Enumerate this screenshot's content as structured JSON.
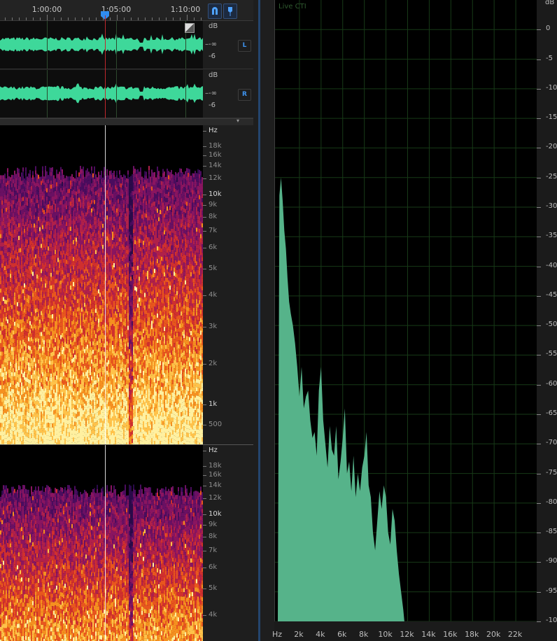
{
  "timeline": {
    "labels": [
      "1:00:00",
      "1:05:00",
      "1:10:00"
    ],
    "playhead": "1:04:25"
  },
  "waveform": {
    "unit": "dB",
    "channels": [
      {
        "badge": "L",
        "scale": [
          "-∞",
          "-6"
        ]
      },
      {
        "badge": "R",
        "scale": [
          "-∞",
          "-6"
        ]
      }
    ],
    "color": "#3ed89a"
  },
  "spectral": {
    "unit": "Hz",
    "top_labels": [
      "18k",
      "16k",
      "14k",
      "12k",
      "10k",
      "9k",
      "8k",
      "7k",
      "6k",
      "5k",
      "4k",
      "3k",
      "2k",
      "1k",
      "500"
    ],
    "bottom_labels": [
      "18k",
      "16k",
      "14k",
      "12k",
      "10k",
      "9k",
      "8k",
      "7k",
      "6k",
      "5k",
      "4k"
    ]
  },
  "frequency_analysis": {
    "live_label": "Live CTI",
    "y_unit": "dB",
    "y_labels": [
      "0",
      "-5",
      "-10",
      "-15",
      "-20",
      "-25",
      "-30",
      "-35",
      "-40",
      "-45",
      "-50",
      "-55",
      "-60",
      "-65",
      "-70",
      "-75",
      "-80",
      "-85",
      "-90",
      "-95",
      "-100"
    ],
    "x_unit": "Hz",
    "x_labels": [
      "2k",
      "4k",
      "6k",
      "8k",
      "10k",
      "12k",
      "14k",
      "16k",
      "18k",
      "20k",
      "22k"
    ],
    "bar_color": "#56b38a"
  },
  "chart_data": {
    "type": "area",
    "title": "",
    "xlabel": "Hz",
    "ylabel": "dB",
    "xlim": [
      0,
      24000
    ],
    "ylim": [
      -100,
      5
    ],
    "x": [
      0,
      150,
      300,
      450,
      600,
      750,
      900,
      1050,
      1200,
      1400,
      1600,
      1800,
      2000,
      2200,
      2400,
      2600,
      2800,
      3000,
      3200,
      3400,
      3600,
      3800,
      4000,
      4200,
      4400,
      4600,
      4800,
      5000,
      5200,
      5400,
      5600,
      5800,
      6000,
      6200,
      6400,
      6600,
      6800,
      7000,
      7200,
      7400,
      7600,
      7800,
      8000,
      8200,
      8400,
      8600,
      8800,
      9000,
      9200,
      9400,
      9600,
      9800,
      10000,
      10200,
      10400,
      10600,
      10800,
      11000,
      11200,
      11400,
      11600,
      11700
    ],
    "values": [
      -100,
      -28,
      -25,
      -29,
      -34,
      -37,
      -42,
      -46,
      -48,
      -50,
      -53,
      -57,
      -62,
      -57,
      -64,
      -62,
      -61,
      -66,
      -69,
      -68,
      -72,
      -61,
      -57,
      -66,
      -70,
      -74,
      -67,
      -71,
      -72,
      -67,
      -76,
      -73,
      -69,
      -64,
      -75,
      -73,
      -78,
      -72,
      -79,
      -75,
      -78,
      -74,
      -72,
      -68,
      -77,
      -79,
      -85,
      -88,
      -83,
      -78,
      -81,
      -77,
      -79,
      -85,
      -87,
      -81,
      -83,
      -88,
      -92,
      -95,
      -98,
      -100
    ]
  }
}
